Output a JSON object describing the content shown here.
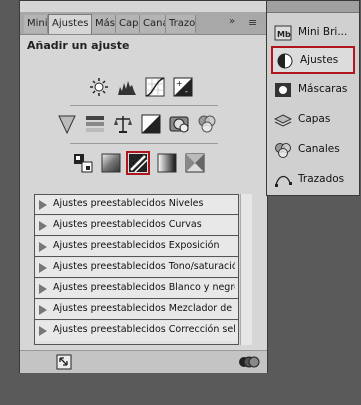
{
  "panel": {
    "tabs": [
      "Mini",
      "Ajustes",
      "Másc",
      "Capa",
      "Cana",
      "Trazo"
    ],
    "double_arrow": "»",
    "menu_icon": "≡",
    "title": "Añadir un ajuste",
    "icon_rows": [
      [
        "brightness-contrast-icon",
        "levels-icon",
        "curves-icon",
        "exposure-icon"
      ],
      [
        "vibrance-icon",
        "hue-saturation-icon",
        "color-balance-icon",
        "black-white-icon",
        "photo-filter-icon",
        "channel-mixer-icon"
      ],
      [
        "invert-icon",
        "posterize-icon",
        "threshold-icon",
        "gradient-map-icon",
        "selective-color-icon"
      ]
    ],
    "presets": [
      "Ajustes preestablecidos Niveles",
      "Ajustes preestablecidos Curvas",
      "Ajustes preestablecidos Exposición",
      "Ajustes preestablecidos Tono/saturación",
      "Ajustes preestablecidos Blanco y negro",
      "Ajustes preestablecidos Mezclador de c...",
      "Ajustes preestablecidos Corrección sele..."
    ]
  },
  "dock": {
    "items": [
      {
        "label": "Mini Bri...",
        "icon": "mini-bridge-icon",
        "selected": false
      },
      {
        "label": "Ajustes",
        "icon": "adjustments-icon",
        "selected": true
      },
      {
        "label": "Máscaras",
        "icon": "masks-icon",
        "selected": false
      },
      {
        "label": "Capas",
        "icon": "layers-icon",
        "selected": false
      },
      {
        "label": "Canales",
        "icon": "channels-icon",
        "selected": false
      },
      {
        "label": "Trazados",
        "icon": "paths-icon",
        "selected": false
      }
    ]
  },
  "colors": {
    "highlight": "#b0141c",
    "panel_bg": "#d6d6d6",
    "workspace": "#5a5a5a"
  }
}
